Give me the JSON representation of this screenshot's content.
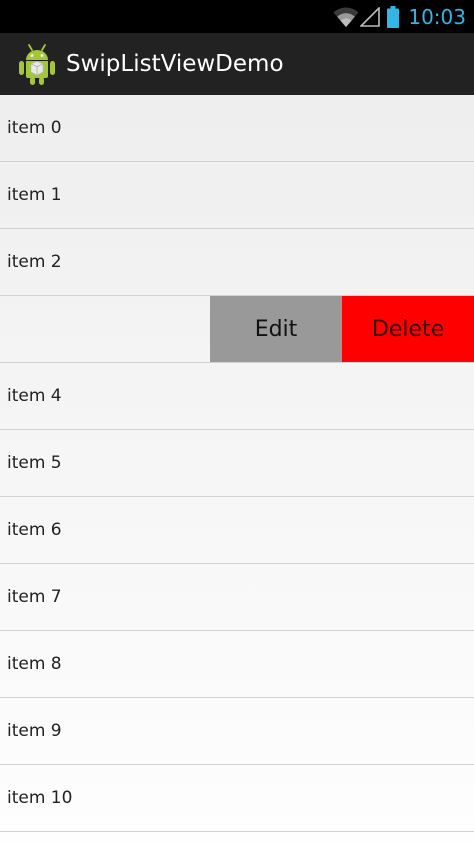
{
  "status_bar": {
    "time": "10:03",
    "icons": [
      "wifi-icon",
      "cell-signal-icon",
      "battery-icon"
    ],
    "clock_color": "#33b5e5"
  },
  "action_bar": {
    "title": "SwipListViewDemo",
    "icon": "android-icon"
  },
  "list": {
    "items": [
      {
        "label": "item 0"
      },
      {
        "label": "item 1"
      },
      {
        "label": "item 2"
      },
      {
        "label": "",
        "swiped": true
      },
      {
        "label": "item 4"
      },
      {
        "label": "item 5"
      },
      {
        "label": "item 6"
      },
      {
        "label": "item 7"
      },
      {
        "label": "item 8"
      },
      {
        "label": "item 9"
      },
      {
        "label": "item 10"
      }
    ],
    "swipe_actions": {
      "edit_label": "Edit",
      "delete_label": "Delete",
      "edit_color": "#999999",
      "delete_color": "#ff0000"
    }
  }
}
